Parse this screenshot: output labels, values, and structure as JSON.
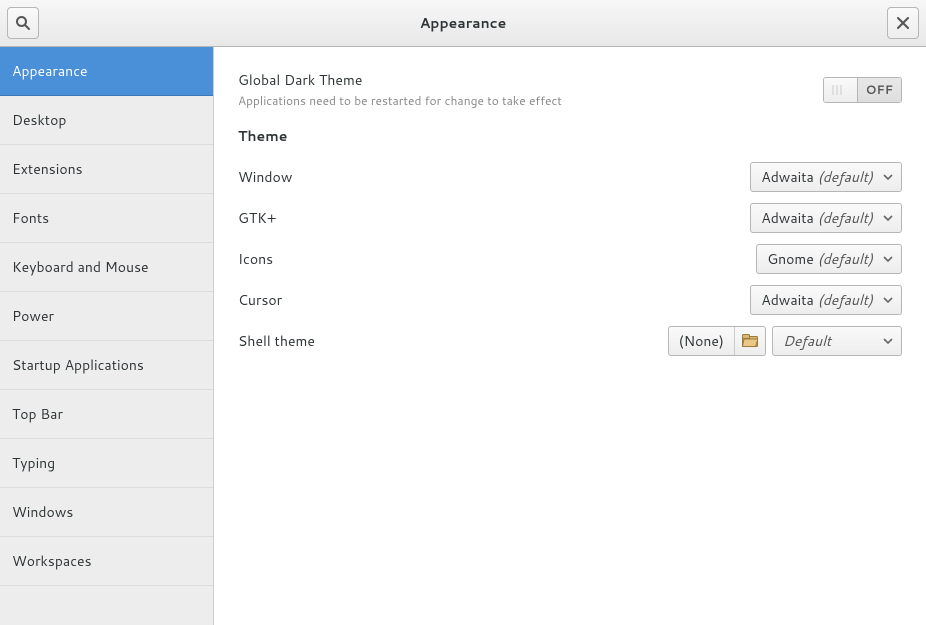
{
  "header": {
    "title": "Appearance"
  },
  "sidebar": {
    "items": [
      {
        "label": "Appearance",
        "selected": true
      },
      {
        "label": "Desktop",
        "selected": false
      },
      {
        "label": "Extensions",
        "selected": false
      },
      {
        "label": "Fonts",
        "selected": false
      },
      {
        "label": "Keyboard and Mouse",
        "selected": false
      },
      {
        "label": "Power",
        "selected": false
      },
      {
        "label": "Startup Applications",
        "selected": false
      },
      {
        "label": "Top Bar",
        "selected": false
      },
      {
        "label": "Typing",
        "selected": false
      },
      {
        "label": "Windows",
        "selected": false
      },
      {
        "label": "Workspaces",
        "selected": false
      }
    ]
  },
  "main": {
    "global_dark": {
      "title": "Global Dark Theme",
      "subtitle": "Applications need to be restarted for change to take effect",
      "toggle_state": "OFF"
    },
    "theme_section": "Theme",
    "rows": {
      "window": {
        "label": "Window",
        "value": "Adwaita",
        "suffix": "(default)"
      },
      "gtk": {
        "label": "GTK+",
        "value": "Adwaita",
        "suffix": "(default)"
      },
      "icons": {
        "label": "Icons",
        "value": "Gnome",
        "suffix": "(default)"
      },
      "cursor": {
        "label": "Cursor",
        "value": "Adwaita",
        "suffix": "(default)"
      },
      "shell": {
        "label": "Shell theme",
        "file": "(None)",
        "value": "Default"
      }
    }
  }
}
